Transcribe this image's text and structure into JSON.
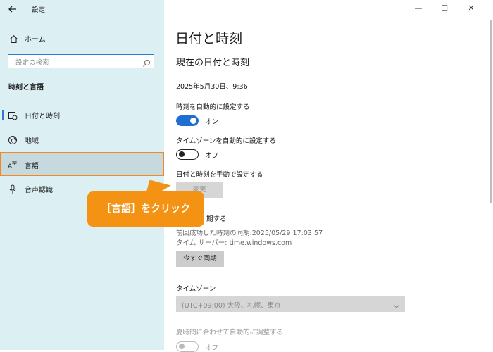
{
  "window": {
    "title": "設定"
  },
  "sidebar": {
    "home_label": "ホーム",
    "search_placeholder": "設定の検索",
    "section_title": "時刻と言語",
    "items": [
      {
        "label": "日付と時刻",
        "icon": "calendar-clock-icon"
      },
      {
        "label": "地域",
        "icon": "globe-region-icon"
      },
      {
        "label": "言語",
        "icon": "language-icon"
      },
      {
        "label": "音声認識",
        "icon": "microphone-icon"
      }
    ]
  },
  "callout": {
    "text": "［言語］をクリック"
  },
  "main": {
    "page_title": "日付と時刻",
    "subtitle": "現在の日付と時刻",
    "current_datetime": "2025年5月30日、9:36",
    "auto_time_label": "時刻を自動的に設定する",
    "auto_time_state": "オン",
    "auto_timezone_label": "タイムゾーンを自動的に設定する",
    "auto_timezone_state": "オフ",
    "manual_label": "日付と時刻を手動で設定する",
    "change_button": "変更",
    "sync_heading": "期する",
    "last_sync": "前回成功した時刻の同期:2025/05/29 17:03:57",
    "time_server": "タイム サーバー: time.windows.com",
    "sync_now_button": "今すぐ同期",
    "timezone_label": "タイムゾーン",
    "timezone_value": "(UTC+09:00) 大阪、札幌、東京",
    "dst_label": "夏時間に合わせて自動的に調整する",
    "dst_state": "オフ"
  },
  "colors": {
    "sidebar_bg": "#dceff3",
    "accent": "#1f6fd1",
    "callout": "#f39213",
    "highlight_border": "#f08a1e"
  }
}
